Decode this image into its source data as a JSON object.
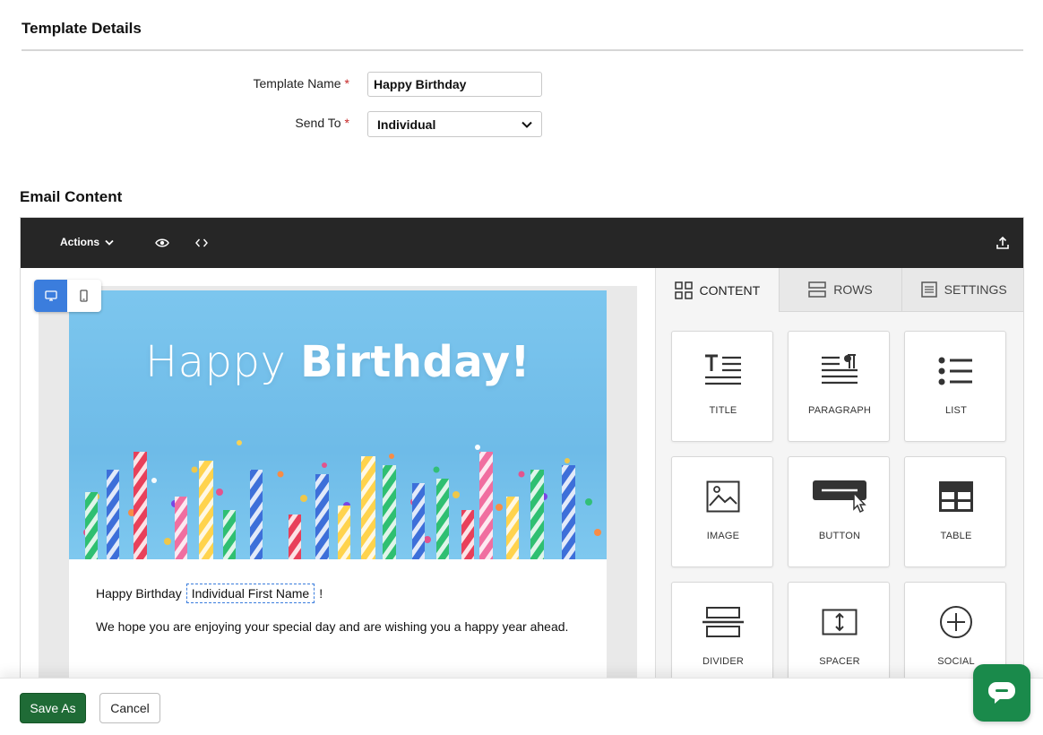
{
  "template_details": {
    "title": "Template Details",
    "name_label": "Template Name",
    "name_value": "Happy Birthday",
    "send_to_label": "Send To",
    "send_to_value": "Individual",
    "required_mark": "*"
  },
  "email_content": {
    "title": "Email Content"
  },
  "toolbar": {
    "actions_label": "Actions",
    "icons": [
      "chevron-down-icon",
      "eye-icon",
      "code-icon",
      "upload-icon"
    ]
  },
  "canvas": {
    "hero_text_light": "Happy ",
    "hero_text_bold": "Birthday!",
    "greeting_prefix": "Happy Birthday",
    "merge_tag": "Individual First Name",
    "greeting_suffix": "!",
    "body_text": "We hope you are enjoying your special day and are wishing you a happy year ahead."
  },
  "panel": {
    "tabs": [
      {
        "label": "CONTENT",
        "icon": "grid-icon",
        "active": true
      },
      {
        "label": "ROWS",
        "icon": "rows-icon",
        "active": false
      },
      {
        "label": "SETTINGS",
        "icon": "settings-list-icon",
        "active": false
      }
    ],
    "blocks": [
      {
        "label": "TITLE",
        "icon": "title-icon"
      },
      {
        "label": "PARAGRAPH",
        "icon": "paragraph-icon"
      },
      {
        "label": "LIST",
        "icon": "list-icon"
      },
      {
        "label": "IMAGE",
        "icon": "image-icon"
      },
      {
        "label": "BUTTON",
        "icon": "button-icon"
      },
      {
        "label": "TABLE",
        "icon": "table-icon"
      },
      {
        "label": "DIVIDER",
        "icon": "divider-icon"
      },
      {
        "label": "SPACER",
        "icon": "spacer-icon"
      },
      {
        "label": "SOCIAL",
        "icon": "social-icon"
      }
    ]
  },
  "footer": {
    "save_as_label": "Save As",
    "cancel_label": "Cancel"
  },
  "colors": {
    "primary_green": "#1f6b36",
    "chat_green": "#1a8a4b",
    "accent_blue": "#3b7ddd",
    "toolbar_dark": "#262626",
    "required_red": "#c62828"
  }
}
